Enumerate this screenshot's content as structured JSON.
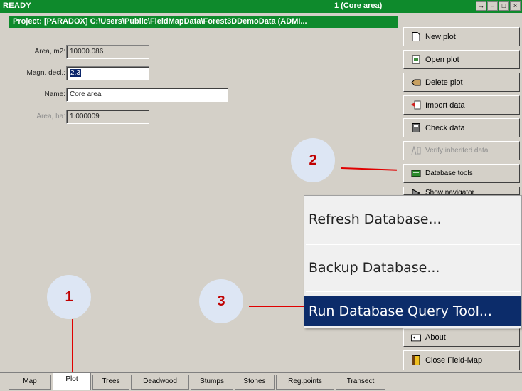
{
  "titlebar": {
    "status": "READY",
    "plot_name": "1 (Core area)",
    "window_buttons": [
      "→",
      "–",
      "□",
      "×"
    ]
  },
  "project_bar": "Project:   [PARADOX] C:\\Users\\Public\\FieldMapData\\Forest3DDemoData   (ADMI...",
  "form": {
    "area_m2": {
      "label": "Area, m2:",
      "value": "10000.086"
    },
    "magn_decl": {
      "label": "Magn. decl.:",
      "value": "2.3"
    },
    "name": {
      "label": "Name:",
      "value": "Core area"
    },
    "area_ha": {
      "label": "Area, ha:",
      "value": "1.000009"
    }
  },
  "right_buttons": [
    {
      "label": "New plot",
      "icon": "new-plot-icon"
    },
    {
      "label": "Open plot",
      "icon": "open-plot-icon"
    },
    {
      "label": "Delete plot",
      "icon": "delete-plot-icon"
    },
    {
      "label": "Import data",
      "icon": "import-data-icon"
    },
    {
      "label": "Check data",
      "icon": "check-data-icon"
    },
    {
      "label": "Verify inherited data",
      "icon": "verify-data-icon"
    },
    {
      "label": "Database tools",
      "icon": "database-tools-icon"
    },
    {
      "label": "Show navigator",
      "icon": "navigator-icon"
    },
    {
      "label": "About",
      "icon": "about-icon"
    },
    {
      "label": "Close Field-Map",
      "icon": "close-fieldmap-icon"
    }
  ],
  "popup_menu": {
    "items": [
      "Refresh Database...",
      "Backup Database...",
      "Run Database Query Tool..."
    ],
    "highlighted": "Run Database Query Tool..."
  },
  "tabs": [
    "Map",
    "Plot",
    "Trees",
    "Deadwood",
    "Stumps",
    "Stones",
    "Reg.points",
    "Transect"
  ],
  "active_tab": "Plot",
  "callouts": [
    "1",
    "2",
    "3"
  ],
  "colors": {
    "titlebar_green": "#0e8a2c",
    "panel_gray": "#d4d0c8",
    "menu_highlight": "#0c2c6a",
    "callout_fill": "#dde6f4",
    "callout_text": "#c00000",
    "pointer_line": "#e00000"
  }
}
